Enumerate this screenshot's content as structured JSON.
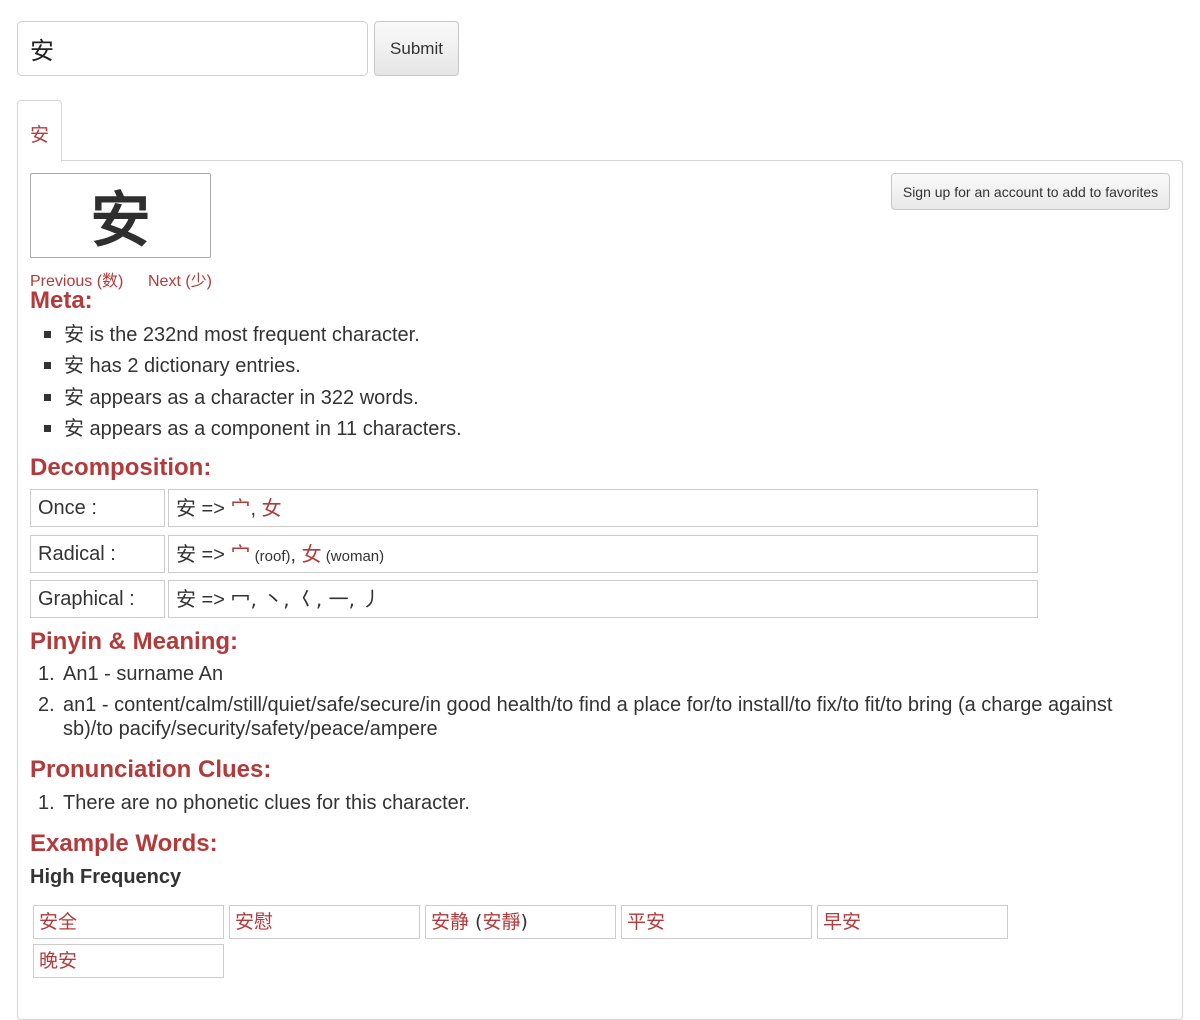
{
  "search": {
    "value": "安"
  },
  "submit_label": "Submit",
  "tab_label": "安",
  "character": "安",
  "nav": {
    "previous": "Previous (数)",
    "next": "Next (少)"
  },
  "favorites_label": "Sign up for an account to add to favorites",
  "meta": {
    "heading": "Meta:",
    "items": [
      {
        "char": "安",
        "text": " is the 232nd most frequent character."
      },
      {
        "char": "安",
        "text": " has 2 dictionary entries."
      },
      {
        "char": "安",
        "text": " appears as a character in 322 words."
      },
      {
        "char": "安",
        "text": " appears as a component in 11 characters."
      }
    ]
  },
  "decomposition": {
    "heading": "Decomposition:",
    "once": {
      "label": "Once :",
      "char": "安",
      "arrow": " => ",
      "c1": "宀",
      "sep": ", ",
      "c2": "女"
    },
    "radical": {
      "label": "Radical :",
      "char": "安",
      "arrow": " => ",
      "c1": "宀",
      "c1_note": " (roof)",
      "sep": ", ",
      "c2": "女",
      "c2_note": " (woman)"
    },
    "graphical": {
      "label": "Graphical :",
      "char": "安",
      "arrow": " => ",
      "strokes": "冖, 丶, 𡿨, 一, 丿"
    }
  },
  "pinyin": {
    "heading": "Pinyin & Meaning:",
    "items": [
      {
        "num": "1.",
        "text": "An1 - surname An"
      },
      {
        "num": "2.",
        "text": "an1 - content/calm/still/quiet/safe/secure/in good health/to find a place for/to install/to fix/to fit/to bring (a charge against sb)/to pacify/security/safety/peace/ampere"
      }
    ]
  },
  "pronunciation": {
    "heading": "Pronunciation Clues:",
    "items": [
      {
        "num": "1.",
        "text": "There are no phonetic clues for this character."
      }
    ]
  },
  "examples": {
    "heading": "Example Words:",
    "subheading": "High Frequency",
    "words": [
      {
        "word": "安全"
      },
      {
        "word": "安慰"
      },
      {
        "word": "安静",
        "open": " (",
        "traditional": "安靜",
        "close": ")"
      },
      {
        "word": "平安"
      },
      {
        "word": "早安"
      },
      {
        "word": "晚安"
      }
    ]
  }
}
